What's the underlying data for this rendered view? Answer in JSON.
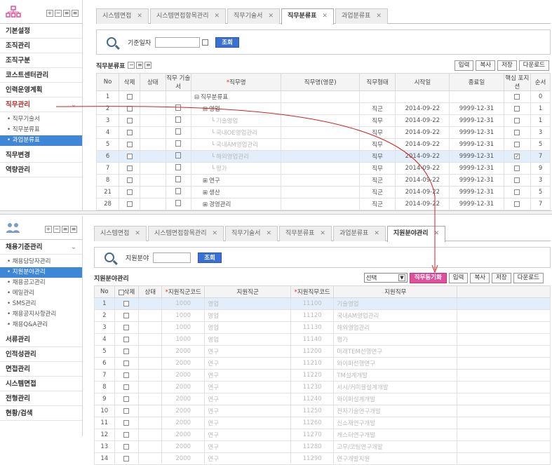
{
  "top": {
    "sidebar": {
      "menu": [
        {
          "label": "기본설정"
        },
        {
          "label": "조직관리"
        },
        {
          "label": "조직구분"
        },
        {
          "label": "코스트센터관리"
        },
        {
          "label": "인력운영계획"
        }
      ],
      "open_menu": "직무관리",
      "sub": [
        {
          "label": "직무기술서",
          "active": false
        },
        {
          "label": "직무분류표",
          "active": false
        },
        {
          "label": "과업분류표",
          "active": true
        }
      ],
      "menu_after": [
        {
          "label": "직무변경"
        },
        {
          "label": "역량관리"
        }
      ]
    },
    "tabs": [
      {
        "label": "시스템면접",
        "active": false
      },
      {
        "label": "시스템면접항목관리",
        "active": false
      },
      {
        "label": "직무기술서",
        "active": false
      },
      {
        "label": "직무분류표",
        "active": true
      },
      {
        "label": "과업분류표",
        "active": false
      }
    ],
    "search": {
      "label": "기준일자",
      "button": "조회"
    },
    "section_title": "직무분류표",
    "actions": [
      "입력",
      "복사",
      "저장",
      "다운로드"
    ],
    "columns": [
      "No",
      "삭제",
      "상태",
      "직무 기술서",
      "직무명",
      "직무명(영문)",
      "직무형태",
      "시작일",
      "종료일",
      "핵심 포지션",
      "순서"
    ],
    "rows": [
      {
        "no": "1",
        "name": "직무분류표",
        "type": "",
        "start": "",
        "end": "",
        "core": false,
        "order": "0",
        "indent": 0,
        "icon": "minus"
      },
      {
        "no": "2",
        "name": "영업",
        "type": "직군",
        "start": "2014-09-22",
        "end": "9999-12-31",
        "core": false,
        "order": "1",
        "indent": 1,
        "icon": "minus"
      },
      {
        "no": "3",
        "name": "기술영업",
        "type": "직무",
        "start": "2014-09-22",
        "end": "9999-12-31",
        "core": false,
        "order": "1",
        "indent": 2,
        "icon": ""
      },
      {
        "no": "4",
        "name": "국내OE영업관리",
        "type": "직무",
        "start": "2014-09-22",
        "end": "9999-12-31",
        "core": false,
        "order": "3",
        "indent": 2,
        "icon": ""
      },
      {
        "no": "5",
        "name": "국내AM영업관리",
        "type": "직무",
        "start": "2014-09-22",
        "end": "9999-12-31",
        "core": false,
        "order": "5",
        "indent": 2,
        "icon": ""
      },
      {
        "no": "6",
        "name": "해외영업관리",
        "type": "직무",
        "start": "2014-09-22",
        "end": "9999-12-31",
        "core": true,
        "order": "7",
        "indent": 2,
        "icon": ""
      },
      {
        "no": "7",
        "name": "평가",
        "type": "직무",
        "start": "2014-09-22",
        "end": "9999-12-31",
        "core": false,
        "order": "9",
        "indent": 2,
        "icon": ""
      },
      {
        "no": "8",
        "name": "연구",
        "type": "직군",
        "start": "2014-09-22",
        "end": "9999-12-31",
        "core": false,
        "order": "3",
        "indent": 1,
        "icon": "plus"
      },
      {
        "no": "21",
        "name": "생산",
        "type": "직군",
        "start": "2014-09-22",
        "end": "9999-12-31",
        "core": false,
        "order": "5",
        "indent": 1,
        "icon": "plus"
      },
      {
        "no": "28",
        "name": "경영관리",
        "type": "직군",
        "start": "2014-09-22",
        "end": "9999-12-31",
        "core": false,
        "order": "7",
        "indent": 1,
        "icon": "plus"
      }
    ]
  },
  "bottom": {
    "sidebar": {
      "open_menu": "채용기준관리",
      "sub": [
        {
          "label": "채용담당자관리",
          "active": false
        },
        {
          "label": "지원분야관리",
          "active": true
        },
        {
          "label": "채용공고관리",
          "active": false
        },
        {
          "label": "메일관리",
          "active": false
        },
        {
          "label": "SMS관리",
          "active": false
        },
        {
          "label": "채용공지사항관리",
          "active": false
        },
        {
          "label": "채용Q&A관리",
          "active": false
        }
      ],
      "menu_after": [
        {
          "label": "서류관리"
        },
        {
          "label": "인적성관리"
        },
        {
          "label": "면접관리"
        },
        {
          "label": "시스템면접"
        },
        {
          "label": "전형관리"
        },
        {
          "label": "현황/검색"
        }
      ]
    },
    "tabs": [
      {
        "label": "시스템면접",
        "active": false
      },
      {
        "label": "시스템면접항목관리",
        "active": false
      },
      {
        "label": "직무기술서",
        "active": false
      },
      {
        "label": "직무분류표",
        "active": false
      },
      {
        "label": "과업분류표",
        "active": false
      },
      {
        "label": "지원분야관리",
        "active": true
      }
    ],
    "search": {
      "label": "지원분야",
      "button": "조회"
    },
    "section_title": "지원분야관리",
    "select_value": "선택",
    "actions": {
      "pink": "직무동기화",
      "others": [
        "입력",
        "복사",
        "저장",
        "다운로드"
      ]
    },
    "columns": [
      "No",
      "삭제",
      "상태",
      "지원직군코드",
      "지원직군",
      "지원직무코드",
      "지원직무"
    ],
    "rows": [
      {
        "no": "1",
        "gcode": "1000",
        "group": "영업",
        "jcode": "11100",
        "job": "기술영업"
      },
      {
        "no": "2",
        "gcode": "1000",
        "group": "영업",
        "jcode": "11120",
        "job": "국내AM영업관리"
      },
      {
        "no": "3",
        "gcode": "1000",
        "group": "영업",
        "jcode": "11130",
        "job": "해외영업관리"
      },
      {
        "no": "4",
        "gcode": "1000",
        "group": "영업",
        "jcode": "11140",
        "job": "평가"
      },
      {
        "no": "5",
        "gcode": "2000",
        "group": "연구",
        "jcode": "11200",
        "job": "미래TEM선행연구"
      },
      {
        "no": "6",
        "gcode": "2000",
        "group": "연구",
        "jcode": "11210",
        "job": "와이퍼선행연구"
      },
      {
        "no": "7",
        "gcode": "2000",
        "group": "연구",
        "jcode": "11220",
        "job": "TM설계개발"
      },
      {
        "no": "8",
        "gcode": "2000",
        "group": "연구",
        "jcode": "11230",
        "job": "서시/커미블설계개발"
      },
      {
        "no": "9",
        "gcode": "2000",
        "group": "연구",
        "jcode": "11240",
        "job": "와이퍼설계개발"
      },
      {
        "no": "10",
        "gcode": "2000",
        "group": "연구",
        "jcode": "11250",
        "job": "전자기술연구개발"
      },
      {
        "no": "11",
        "gcode": "2000",
        "group": "연구",
        "jcode": "11260",
        "job": "신소재연구개발"
      },
      {
        "no": "12",
        "gcode": "2000",
        "group": "연구",
        "jcode": "11270",
        "job": "캐스터연구개발"
      },
      {
        "no": "13",
        "gcode": "2000",
        "group": "연구",
        "jcode": "11280",
        "job": "고무/코팅연구개발"
      },
      {
        "no": "14",
        "gcode": "2000",
        "group": "연구",
        "jcode": "11290",
        "job": "연구개발지원"
      }
    ]
  },
  "colors": {
    "accent": "#3a6fd4",
    "pink": "#e0509a",
    "active_sub": "#3e86d8",
    "arrow": "#d62020"
  }
}
